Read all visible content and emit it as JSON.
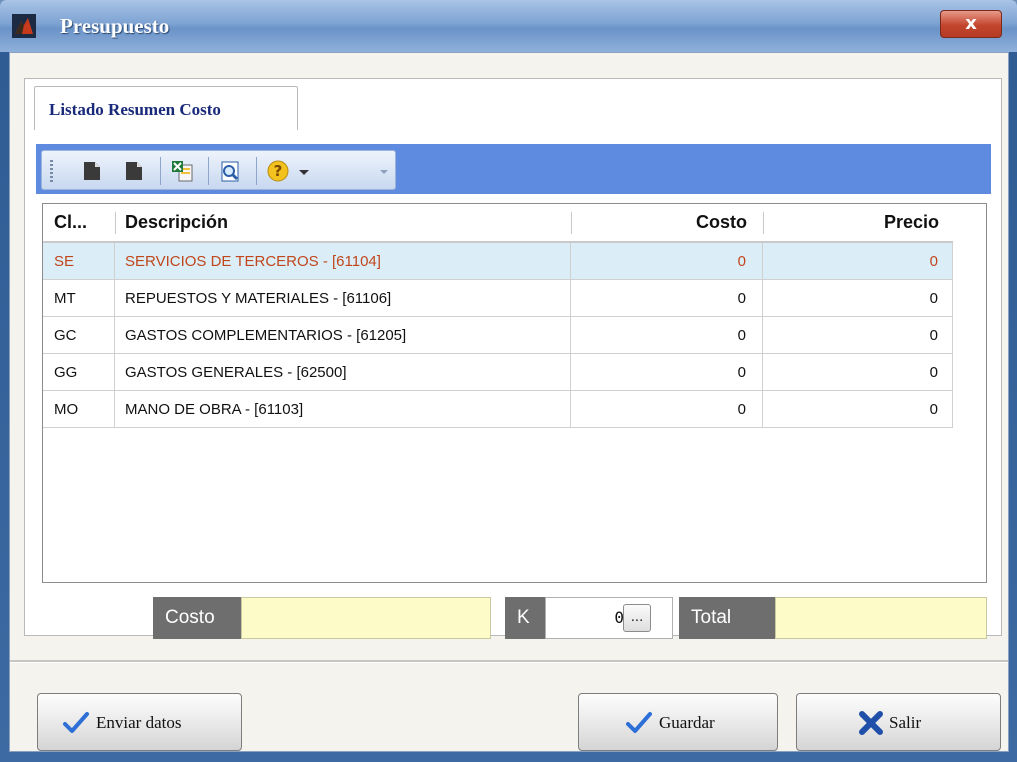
{
  "window": {
    "title": "Presupuesto",
    "close_label": "x"
  },
  "tabs": [
    {
      "label": "Listado Resumen Costo"
    }
  ],
  "toolbar": {
    "buttons": [
      {
        "icon": "new-document-icon"
      },
      {
        "icon": "edit-document-icon"
      },
      {
        "icon": "excel-export-icon"
      },
      {
        "icon": "print-preview-icon"
      },
      {
        "icon": "help-icon"
      }
    ]
  },
  "grid": {
    "columns": [
      "Cl...",
      "Descripción",
      "Costo",
      "Precio"
    ],
    "rows": [
      {
        "clase": "SE",
        "descripcion": "SERVICIOS DE TERCEROS - [61104]",
        "costo": "0",
        "precio": "0",
        "selected": true
      },
      {
        "clase": "MT",
        "descripcion": "REPUESTOS Y MATERIALES - [61106]",
        "costo": "0",
        "precio": "0"
      },
      {
        "clase": "GC",
        "descripcion": "GASTOS COMPLEMENTARIOS - [61205]",
        "costo": "0",
        "precio": "0"
      },
      {
        "clase": "GG",
        "descripcion": "GASTOS GENERALES - [62500]",
        "costo": "0",
        "precio": "0"
      },
      {
        "clase": "MO",
        "descripcion": "MANO DE OBRA - [61103]",
        "costo": "0",
        "precio": "0"
      }
    ]
  },
  "summary": {
    "costo_label": "Costo",
    "costo_value": "",
    "k_label": "K",
    "k_value": "0",
    "k_button": "...",
    "total_label": "Total",
    "total_value": ""
  },
  "buttons": {
    "enviar": "Enviar datos",
    "guardar": "Guardar",
    "salir": "Salir"
  },
  "colors": {
    "selected_row_text": "#c0461b",
    "toolbar_band": "#5e8be0",
    "summary_field": "#fdfbc8"
  }
}
